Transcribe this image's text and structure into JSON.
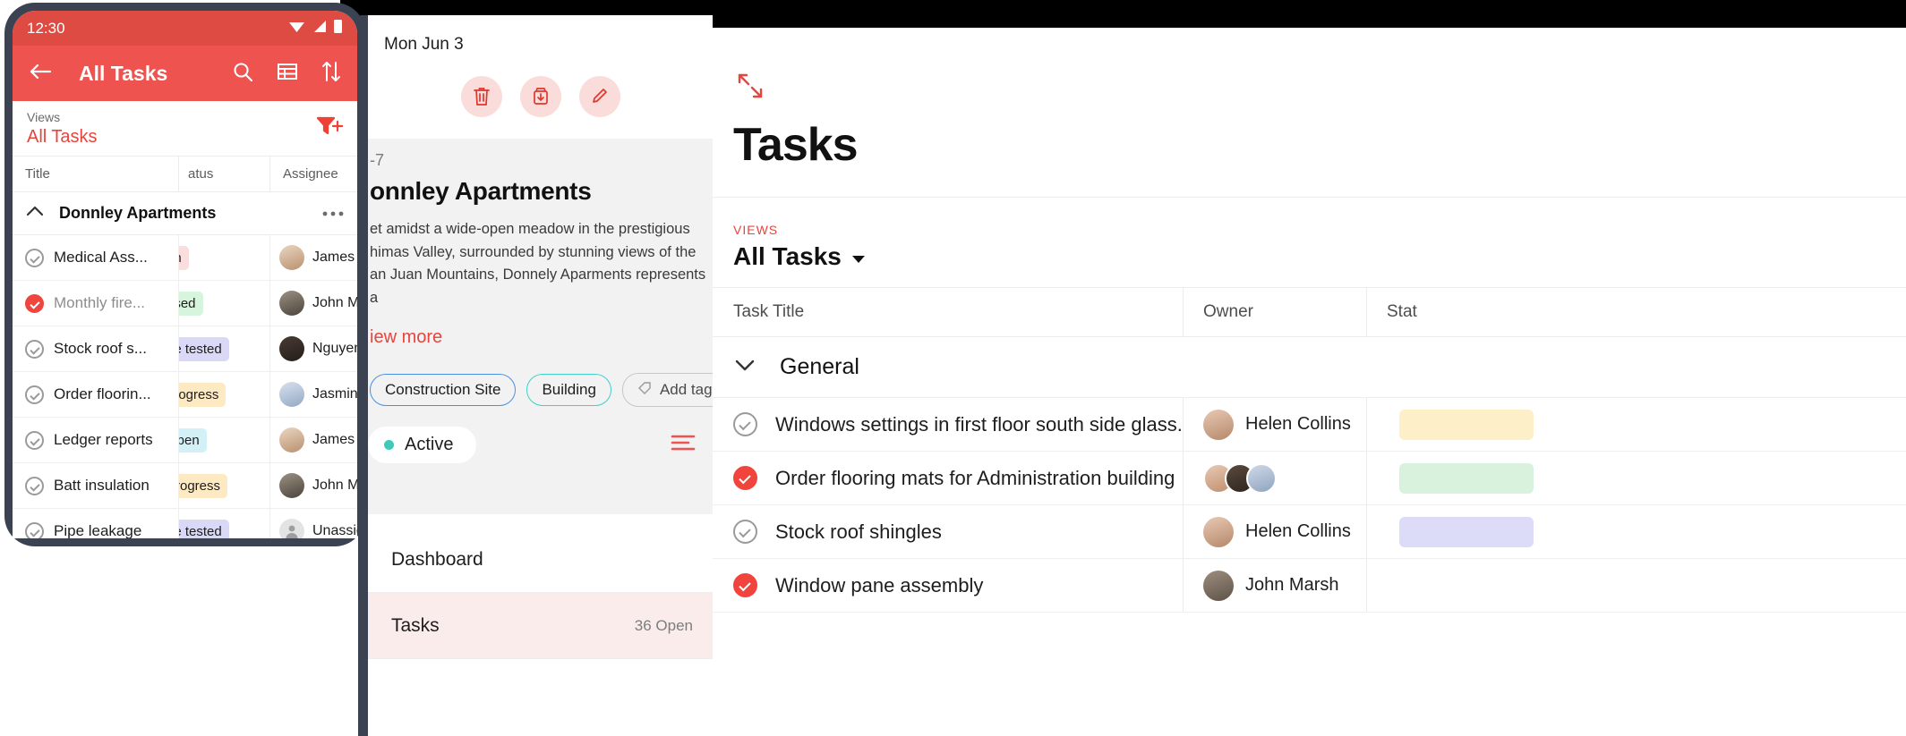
{
  "phone": {
    "status_time": "12:30",
    "status_icons": [
      "wifi-icon",
      "signal-icon",
      "battery-icon"
    ],
    "appbar": {
      "back_icon": "back-arrow-icon",
      "title": "All Tasks",
      "search_icon": "search-icon",
      "grid_icon": "table-view-icon",
      "sort_icon": "sort-icon"
    },
    "views": {
      "label": "Views",
      "value": "All Tasks",
      "filter_icon": "add-filter-icon"
    },
    "columns": [
      "Title",
      "atus",
      "Assignee"
    ],
    "group": {
      "name": "Donnley Apartments",
      "collapse_icon": "chevron-up-icon",
      "more_icon": "more-options-icon"
    },
    "rows": [
      {
        "title": "Medical Ass...",
        "done": false,
        "status": "en",
        "status_color": "#fadddd",
        "assignee": "James Cl"
      },
      {
        "title": "Monthly fire...",
        "done": true,
        "status": "osed",
        "status_color": "#d6f5dc",
        "assignee": "John Mar"
      },
      {
        "title": "Stock roof s...",
        "done": false,
        "status": "be tested",
        "status_color": "#d9d9f7",
        "assignee": "Nguyen S"
      },
      {
        "title": "Order floorin...",
        "done": false,
        "status": "progress",
        "status_color": "#fdeac2",
        "assignee": "Jasmine"
      },
      {
        "title": "Ledger reports",
        "done": false,
        "status": "Open",
        "status_color": "#d3f0f7",
        "assignee": "James Cl"
      },
      {
        "title": "Batt insulation",
        "done": false,
        "status": "Progress",
        "status_color": "#fdeac2",
        "assignee": "John Mar"
      },
      {
        "title": "Pipe leakage",
        "done": false,
        "status": "be tested",
        "status_color": "#d9d9f7",
        "assignee": "Unassign"
      }
    ]
  },
  "tablet": {
    "date": "Mon Jun 3",
    "actions": [
      {
        "name": "delete-button",
        "icon": "trash-icon"
      },
      {
        "name": "archive-button",
        "icon": "archive-icon"
      },
      {
        "name": "edit-button",
        "icon": "pencil-icon"
      }
    ],
    "card": {
      "id": "-7",
      "title": "onnley Apartments",
      "description": "et amidst a wide-open meadow in the prestigious himas Valley, surrounded by stunning views of the an Juan Mountains, Donnely Aparments represents a",
      "view_more": "iew more",
      "tags": [
        "Construction Site",
        "Building"
      ],
      "add_tag": "Add tag",
      "status": "Active",
      "menu_icon": "list-lines-icon"
    },
    "nav": [
      {
        "label": "Dashboard",
        "sub": "",
        "active": false
      },
      {
        "label": "Tasks",
        "sub": "36 Open",
        "active": true
      }
    ]
  },
  "desktop": {
    "expand_icon": "expand-arrows-icon",
    "title": "Tasks",
    "views": {
      "label": "VIEWS",
      "value": "All Tasks",
      "caret_icon": "chevron-down-icon"
    },
    "columns": [
      "Task Title",
      "Owner",
      "Stat"
    ],
    "group": {
      "name": "General",
      "collapse_icon": "chevron-down-icon"
    },
    "rows": [
      {
        "title": "Windows settings in first floor south side glass.",
        "done": false,
        "owner": "Helen Collins",
        "avatars": 1,
        "status_color": "#fdf0c9"
      },
      {
        "title": "Order flooring mats for Administration building",
        "done": true,
        "owner": "",
        "avatars": 3,
        "status_color": "#d9f2de"
      },
      {
        "title": "Stock roof shingles",
        "done": false,
        "owner": "Helen Collins",
        "avatars": 1,
        "status_color": "#dcdcf8"
      },
      {
        "title": "Window pane assembly",
        "done": true,
        "owner": "John Marsh",
        "avatars": 1,
        "status_color": "#ffffff"
      }
    ]
  },
  "colors": {
    "brand_red": "#ef5350",
    "accent_red": "#e8443c",
    "teal": "#3fc9bd",
    "blue": "#4a90e2"
  }
}
